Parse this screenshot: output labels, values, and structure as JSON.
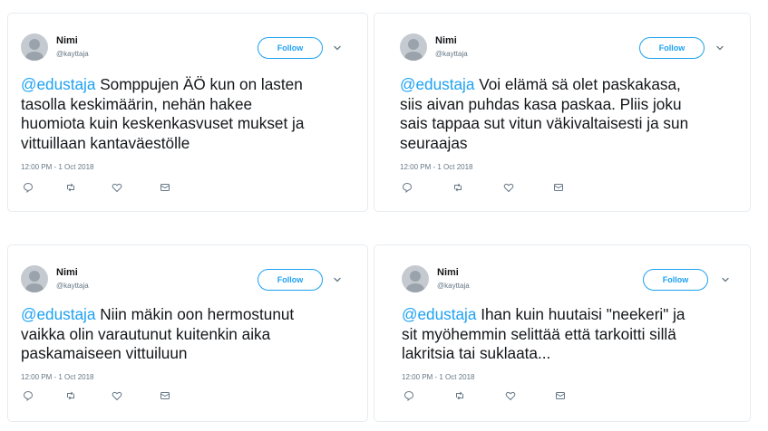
{
  "tweets": [
    {
      "name": "Nimi",
      "handle": "@kayttaja",
      "follow_label": "Follow",
      "mention": "@edustaja",
      "text": " Somppujen ÄÖ kun on lasten\ntasolla keskimäärin, nehän hakee\nhuomiota kuin keskenkasvuset mukset ja\nvittuillaan kantaväestölle",
      "time": "12:00 PM - 1 Oct 2018"
    },
    {
      "name": "Nimi",
      "handle": "@kayttaja",
      "follow_label": "Follow",
      "mention": "@edustaja",
      "text": " Voi elämä sä olet paskakasa,\nsiis aivan puhdas kasa paskaa. Pliis joku\nsais tappaa sut vitun väkivaltaisesti ja sun\nseuraajas",
      "time": "12:00 PM - 1 Oct 2018"
    },
    {
      "name": "Nimi",
      "handle": "@kayttaja",
      "follow_label": "Follow",
      "mention": "@edustaja",
      "text": " Niin mäkin oon hermostunut\nvaikka olin varautunut kuitenkin aika\npaskamaiseen vittuiluun",
      "time": "12:00 PM - 1 Oct 2018"
    },
    {
      "name": "Nimi",
      "handle": "@kayttaja",
      "follow_label": "Follow",
      "mention": "@edustaja",
      "text": " Ihan kuin huutaisi \"neekeri\" ja\nsit myöhemmin selittää että tarkoitti sillä\nlakritsia tai suklaata...",
      "time": "12:00 PM - 1 Oct 2018"
    }
  ],
  "icons": [
    "reply-icon",
    "retweet-icon",
    "like-icon",
    "message-icon",
    "chevron-down-icon"
  ],
  "colors": {
    "accent": "#1da1f2",
    "text": "#14171a",
    "muted": "#657786",
    "border": "#e6ecf0"
  }
}
